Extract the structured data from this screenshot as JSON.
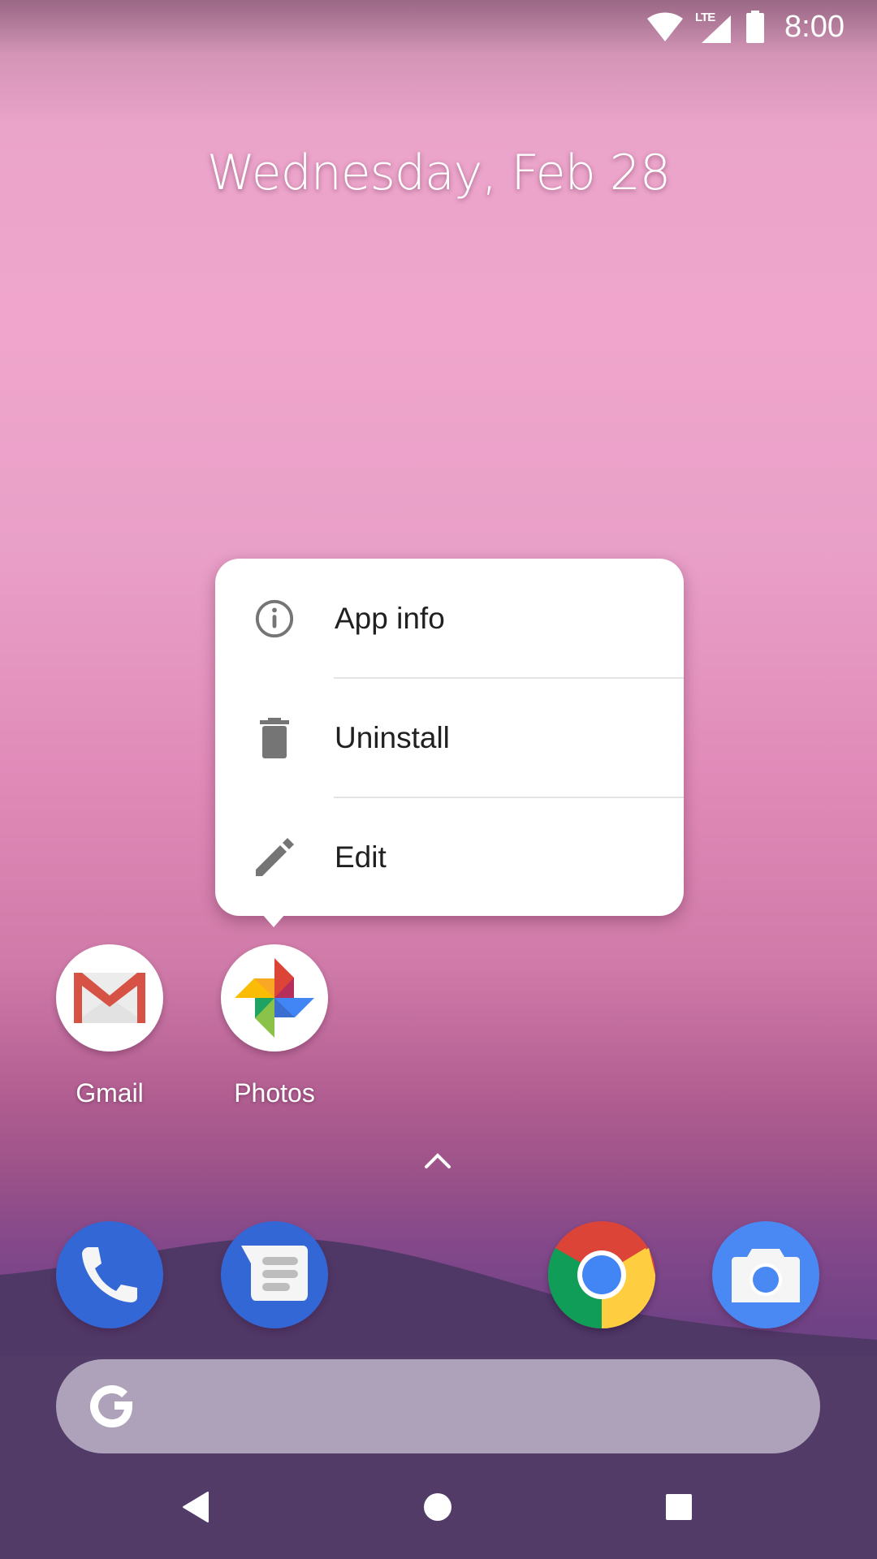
{
  "status_bar": {
    "time": "8:00",
    "icons": [
      "wifi-icon",
      "lte-signal-icon",
      "battery-icon"
    ],
    "network_label": "LTE"
  },
  "home": {
    "date": "Wednesday, Feb 28"
  },
  "context_menu": {
    "items": [
      {
        "label": "App info",
        "icon": "info-icon"
      },
      {
        "label": "Uninstall",
        "icon": "trash-icon"
      },
      {
        "label": "Edit",
        "icon": "pencil-icon"
      }
    ]
  },
  "apps": [
    {
      "label": "Gmail",
      "icon": "gmail-icon"
    },
    {
      "label": "Photos",
      "icon": "photos-icon"
    }
  ],
  "dock": [
    {
      "name": "Phone",
      "icon": "phone-icon"
    },
    {
      "name": "Messages",
      "icon": "messages-icon"
    },
    {
      "name": "Chrome",
      "icon": "chrome-icon"
    },
    {
      "name": "Camera",
      "icon": "camera-icon"
    }
  ],
  "search": {
    "logo": "G"
  },
  "nav": [
    "back",
    "home",
    "recents"
  ],
  "colors": {
    "menu_text": "#202020",
    "menu_icon": "#757575",
    "phone_blue": "#3367d6",
    "camera_blue": "#4a89f3"
  }
}
